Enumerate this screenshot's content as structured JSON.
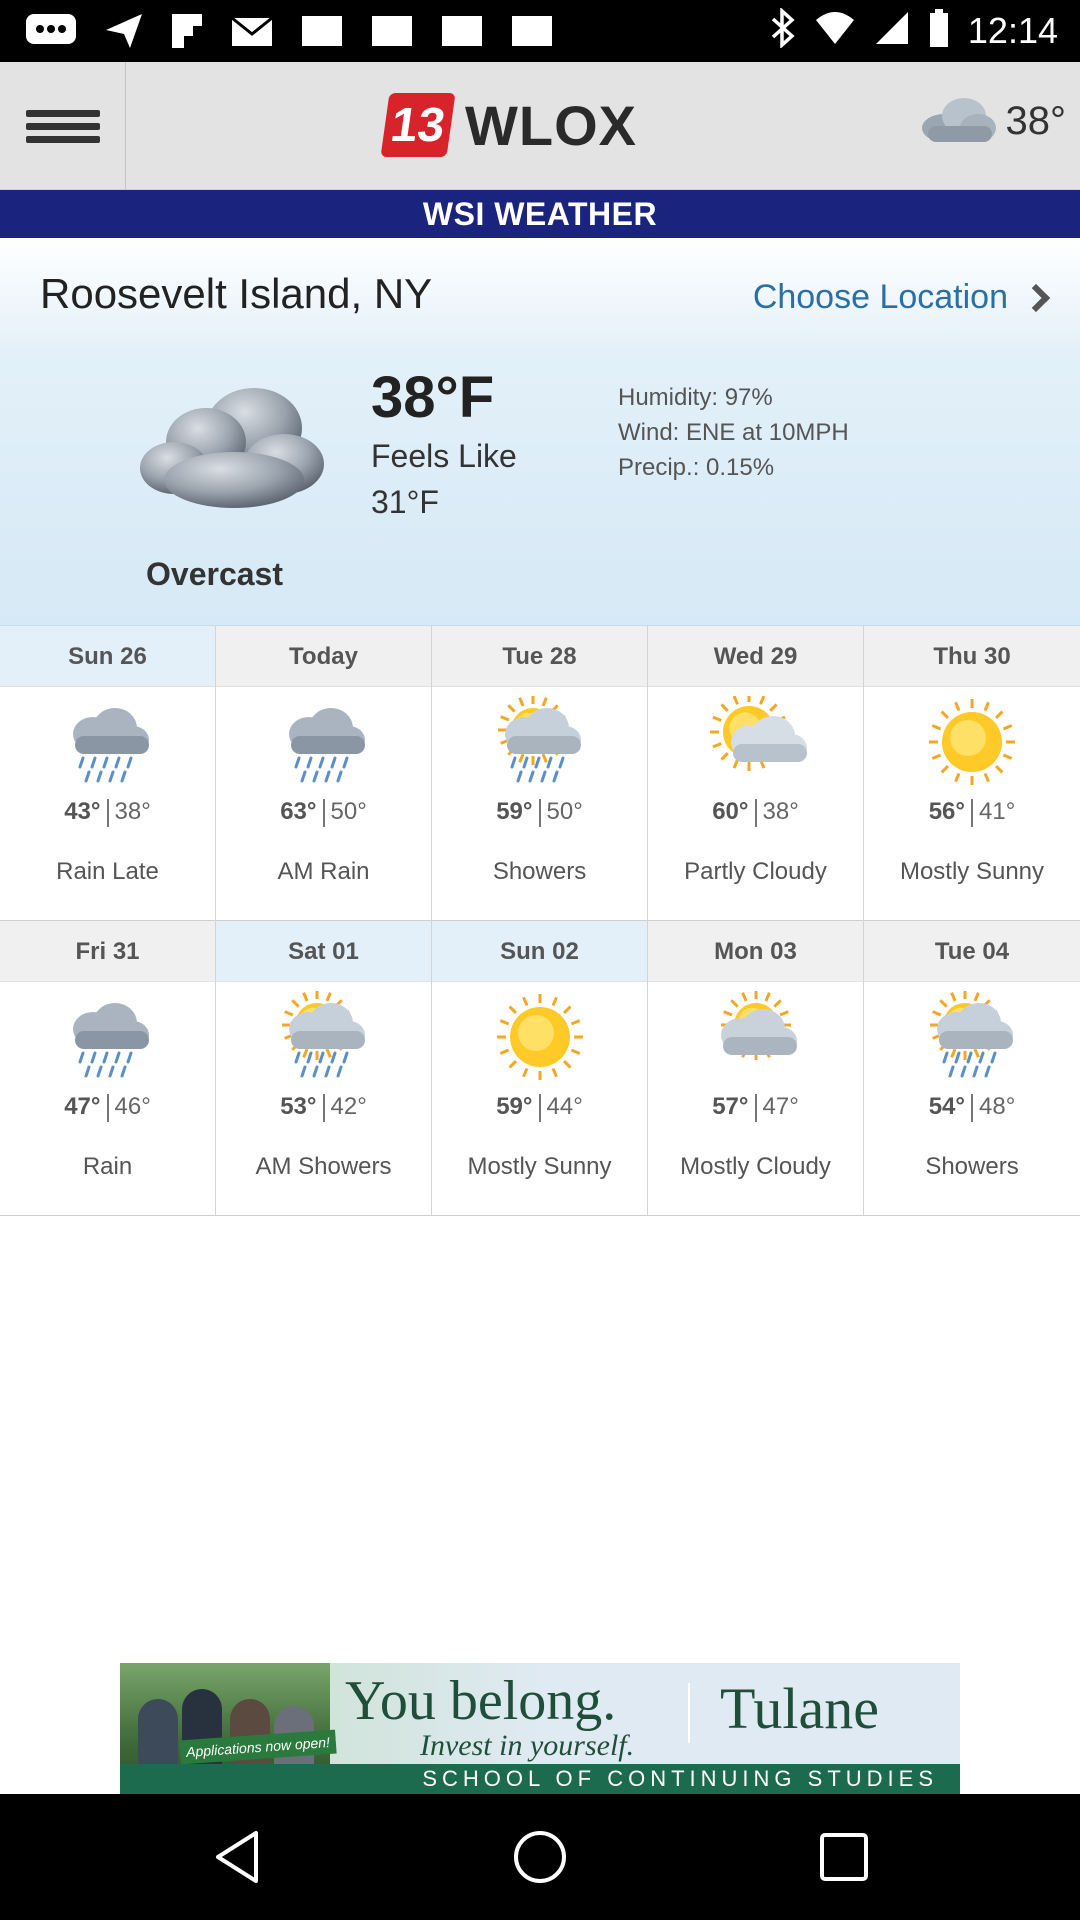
{
  "status_bar": {
    "time": "12:14"
  },
  "header": {
    "logo_number": "13",
    "logo_text": "WLOX",
    "current_temp": "38°"
  },
  "banner": {
    "title": "WSI WEATHER"
  },
  "current": {
    "location": "Roosevelt Island, NY",
    "choose_location": "Choose Location",
    "temperature": "38°F",
    "feels_like_label": "Feels Like",
    "feels_like_value": "31°F",
    "humidity": "Humidity: 97%",
    "wind": "Wind: ENE at 10MPH",
    "precip": "Precip.: 0.15%",
    "condition": "Overcast",
    "icon": "overcast-cloud-icon"
  },
  "forecast": [
    [
      {
        "day": "Sun 26",
        "high": "43°",
        "low": "38°",
        "condition": "Rain Late",
        "icon": "rain-icon",
        "highlight": true
      },
      {
        "day": "Today",
        "high": "63°",
        "low": "50°",
        "condition": "AM Rain",
        "icon": "rain-icon",
        "highlight": false
      },
      {
        "day": "Tue 28",
        "high": "59°",
        "low": "50°",
        "condition": "Showers",
        "icon": "sun-showers-icon",
        "highlight": false
      },
      {
        "day": "Wed 29",
        "high": "60°",
        "low": "38°",
        "condition": "Partly Cloudy",
        "icon": "partly-cloudy-icon",
        "highlight": false
      },
      {
        "day": "Thu 30",
        "high": "56°",
        "low": "41°",
        "condition": "Mostly Sunny",
        "icon": "sun-icon",
        "highlight": false
      }
    ],
    [
      {
        "day": "Fri 31",
        "high": "47°",
        "low": "46°",
        "condition": "Rain",
        "icon": "rain-icon",
        "highlight": false
      },
      {
        "day": "Sat 01",
        "high": "53°",
        "low": "42°",
        "condition": "AM Showers",
        "icon": "sun-showers-icon",
        "highlight": true
      },
      {
        "day": "Sun 02",
        "high": "59°",
        "low": "44°",
        "condition": "Mostly Sunny",
        "icon": "sun-icon",
        "highlight": true
      },
      {
        "day": "Mon 03",
        "high": "57°",
        "low": "47°",
        "condition": "Mostly Cloudy",
        "icon": "mostly-cloudy-icon",
        "highlight": false
      },
      {
        "day": "Tue 04",
        "high": "54°",
        "low": "48°",
        "condition": "Showers",
        "icon": "sun-showers-icon",
        "highlight": false
      }
    ]
  ],
  "ad": {
    "headline": "You belong.",
    "subline": "Invest in yourself.",
    "brand": "Tulane",
    "footer": "SCHOOL OF CONTINUING STUDIES",
    "tag": "Applications now open!"
  },
  "colors": {
    "banner_bg": "#1a237e",
    "link": "#2a6fa8",
    "logo_red": "#d9232a"
  }
}
